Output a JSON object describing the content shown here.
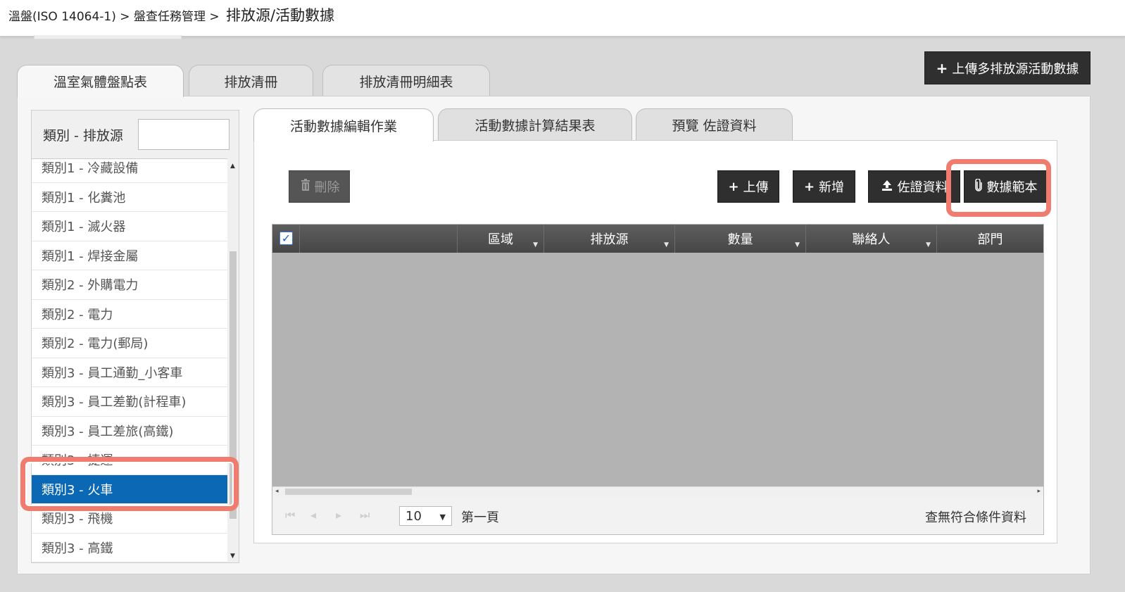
{
  "breadcrumb": {
    "item1": "溫盤(ISO 14064-1) >",
    "item2": "盤查任務管理 >",
    "current": "排放源/活動數據"
  },
  "actions": {
    "upload_multi": "上傳多排放源活動數據",
    "upload_multi_icon": "plus-icon"
  },
  "outer_tabs": [
    {
      "label": "溫室氣體盤點表",
      "active": true
    },
    {
      "label": "排放清冊",
      "active": false
    },
    {
      "label": "排放清冊明細表",
      "active": false
    }
  ],
  "sidebar": {
    "filter_label": "類別 - 排放源",
    "filter_value": "",
    "items": [
      "類別1 - 冷藏設備",
      "類別1 - 化糞池",
      "類別1 - 滅火器",
      "類別1 - 焊接金屬",
      "類別2 - 外購電力",
      "類別2 - 電力",
      "類別2 - 電力(郵局)",
      "類別3 - 員工通勤_小客車",
      "類別3 - 員工差勤(計程車)",
      "類別3 - 員工差旅(高鐵)",
      "類別3 - 捷運",
      "類別3 - 火車",
      "類別3 - 飛機",
      "類別3 - 高鐵"
    ],
    "selected": "類別3 - 火車"
  },
  "inner_tabs": [
    {
      "label": "活動數據編輯作業",
      "active": true
    },
    {
      "label": "活動數據計算結果表",
      "active": false
    },
    {
      "label": "預覽 佐證資料",
      "active": false
    }
  ],
  "toolbar": {
    "delete": "刪除",
    "upload": "上傳",
    "add": "新增",
    "evidence": "佐證資料",
    "template": "數據範本"
  },
  "grid": {
    "columns": [
      "區域",
      "排放源",
      "數量",
      "聯絡人",
      "部門"
    ],
    "select_all_checked": true
  },
  "pager": {
    "page_size": "10",
    "page_label": "第一頁",
    "no_data": "查無符合條件資料"
  }
}
